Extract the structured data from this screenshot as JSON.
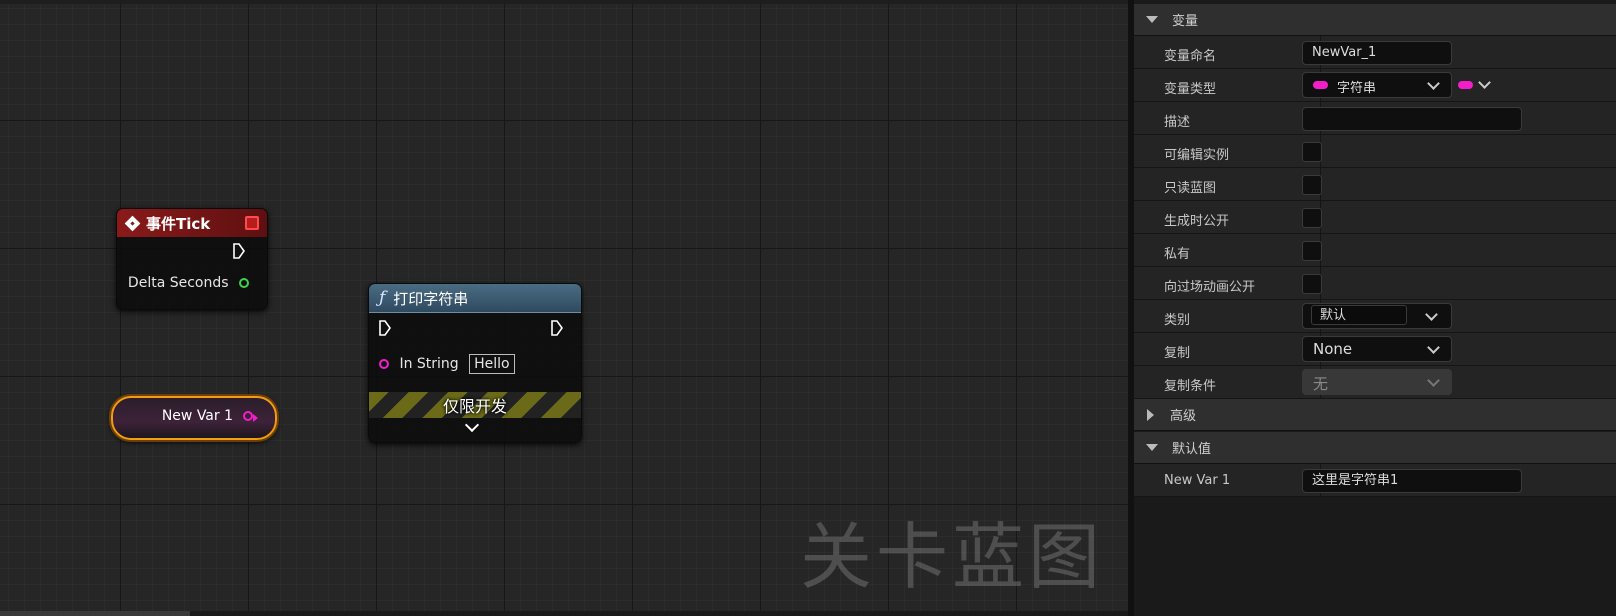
{
  "graph": {
    "watermark": "关卡蓝图",
    "tick_node": {
      "title": "事件Tick",
      "pin_delta": "Delta Seconds"
    },
    "print_node": {
      "title": "打印字符串",
      "pin_in_string": "In String",
      "in_string_value": "Hello",
      "dev_only": "仅限开发"
    },
    "var_node": {
      "label": "New Var 1"
    },
    "colors": {
      "event_header": "#8a1a1a",
      "function_header": "#4a6c84",
      "string_pin": "#f21fc9",
      "float_pin": "#3fd24b",
      "selection": "#f39c12"
    }
  },
  "details": {
    "variable_section": "变量",
    "rows": {
      "name_label": "变量命名",
      "name_value": "NewVar_1",
      "type_label": "变量类型",
      "type_value": "字符串",
      "desc_label": "描述",
      "desc_value": "",
      "instance_editable_label": "可编辑实例",
      "readonly_label": "只读蓝图",
      "expose_spawn_label": "生成时公开",
      "private_label": "私有",
      "expose_cinematics_label": "向过场动画公开",
      "category_label": "类别",
      "category_value": "默认",
      "replication_label": "复制",
      "replication_value": "None",
      "rep_condition_label": "复制条件",
      "rep_condition_value": "无"
    },
    "advanced_section": "高级",
    "default_section": "默认值",
    "default_row": {
      "label": "New Var 1",
      "value": "这里是字符串1"
    }
  }
}
